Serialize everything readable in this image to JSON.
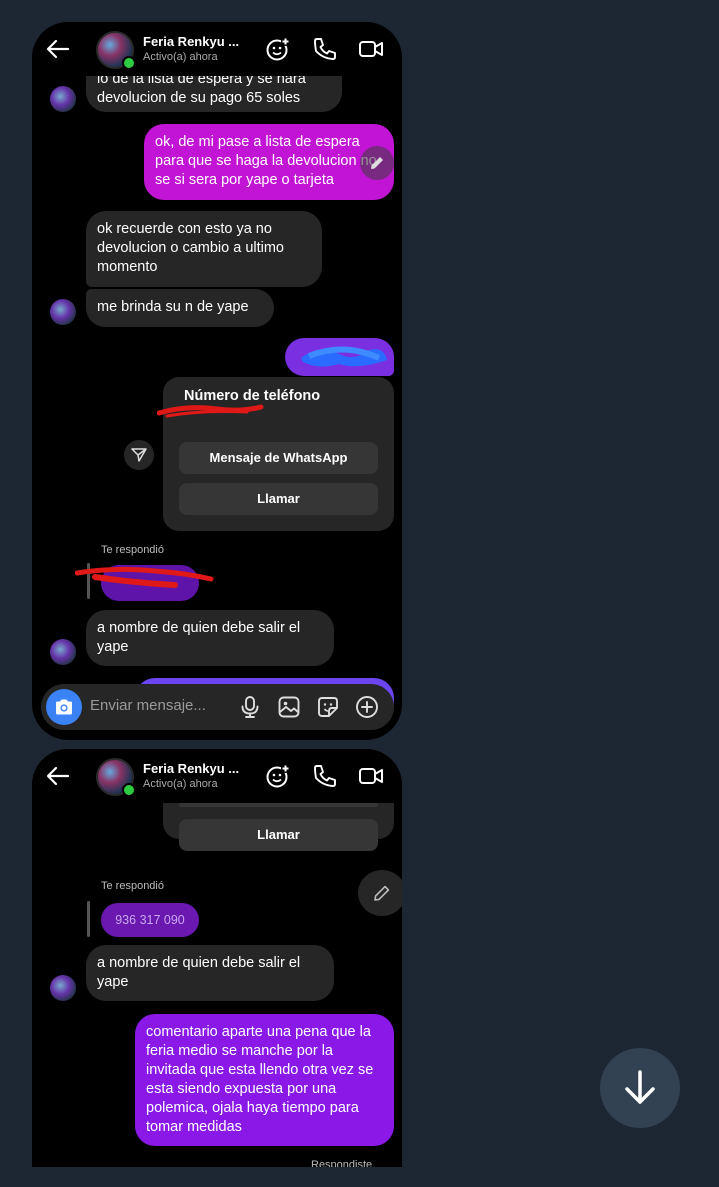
{
  "header": {
    "name": "Feria Renkyu ...",
    "status": "Activo(a) ahora"
  },
  "screen1": {
    "msg_partial": "lo de la lista de espera  y se hara devolucion de su  pago 65  soles",
    "msg_out_1": "ok, de mi pase a lista de espera para que se haga la devolucion no se si sera por yape o tarjeta",
    "msg_in_2": "ok  recuerde con esto ya no devolucion o cambio a ultimo momento",
    "msg_in_3": "me brinda su n de yape",
    "card": {
      "title": "Número de teléfono",
      "whatsapp_button": "Mensaje de WhatsApp",
      "call_button": "Llamar"
    },
    "replied_label": "Te respondió",
    "msg_in_4": "a nombre de quien debe salir el yape"
  },
  "composer": {
    "placeholder": "Enviar mensaje..."
  },
  "screen2": {
    "call_button": "Llamar",
    "replied_label": "Te respondió",
    "reply_quote": "936 317 090",
    "msg_in_1": "a nombre de quien debe salir el yape",
    "msg_out_1": "comentario aparte una pena que la feria medio se manche por la invitada que esta llendo otra vez se esta siendo expuesta por una polemica, ojala haya tiempo para tomar medidas",
    "replied_footer": "Respondiste"
  },
  "colors": {
    "pink_bubble": "#c214d4",
    "purple_bubble": "#8a19e8",
    "incoming_bubble": "#262626",
    "background": "#1d2733",
    "camera_blue": "#3b82f6"
  },
  "icons": [
    "back-arrow-icon",
    "add-effect-icon",
    "phone-icon",
    "video-camera-icon",
    "camera-icon",
    "microphone-icon",
    "gallery-icon",
    "sticker-icon",
    "plus-circle-icon",
    "pencil-icon",
    "forward-icon",
    "arrow-down-icon"
  ]
}
